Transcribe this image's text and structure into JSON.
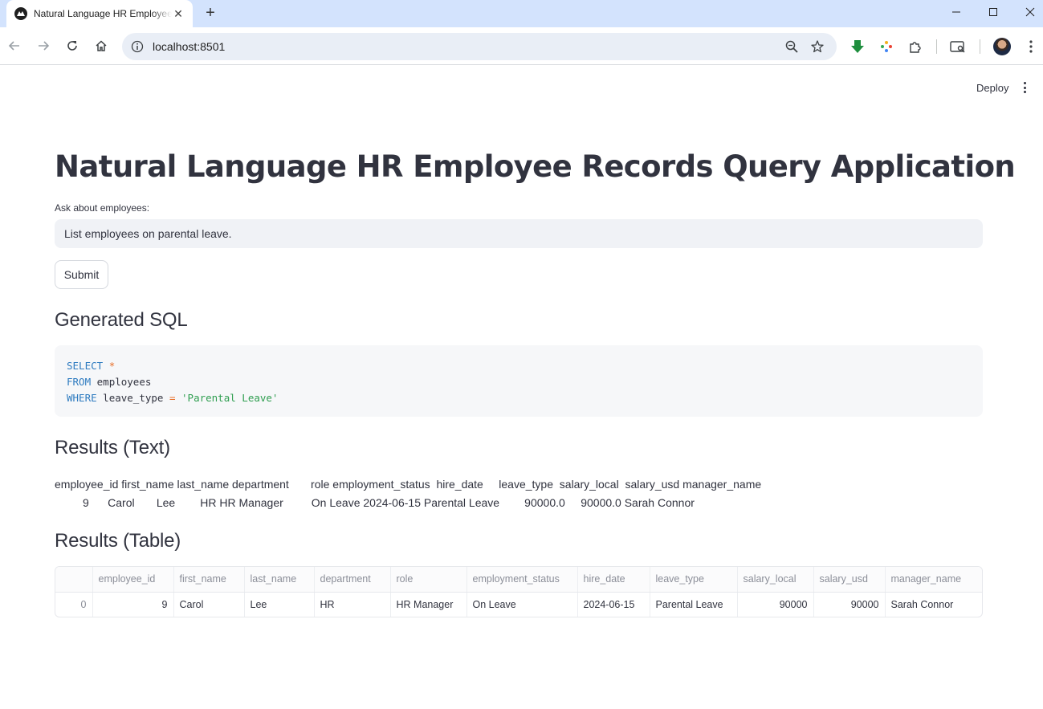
{
  "browser": {
    "tab_title": "Natural Language HR Employee Records Query Application",
    "url": "localhost:8501"
  },
  "app": {
    "deploy_label": "Deploy",
    "title": "Natural Language HR Employee Records Query Application",
    "query_label": "Ask about employees:",
    "query_value": "List employees on parental leave.",
    "submit_label": "Submit",
    "sql_heading": "Generated SQL",
    "sql": {
      "line1_kw": "SELECT",
      "line1_op": "*",
      "line2_kw": "FROM",
      "line2_rest": "employees",
      "line3_kw": "WHERE",
      "line3_col": "leave_type",
      "line3_op": "=",
      "line3_str": "'Parental Leave'"
    },
    "text_heading": "Results (Text)",
    "text_results": {
      "header": "employee_id first_name last_name department       role employment_status  hire_date     leave_type  salary_local  salary_usd manager_name",
      "row": "         9      Carol       Lee        HR HR Manager         On Leave 2024-06-15 Parental Leave        90000.0     90000.0 Sarah Connor"
    },
    "table_heading": "Results (Table)",
    "table": {
      "columns": [
        "",
        "employee_id",
        "first_name",
        "last_name",
        "department",
        "role",
        "employment_status",
        "hire_date",
        "leave_type",
        "salary_local",
        "salary_usd",
        "manager_name"
      ],
      "rows": [
        [
          "0",
          "9",
          "Carol",
          "Lee",
          "HR",
          "HR Manager",
          "On Leave",
          "2024-06-15",
          "Parental Leave",
          "90000",
          "90000",
          "Sarah Connor"
        ]
      ]
    }
  }
}
